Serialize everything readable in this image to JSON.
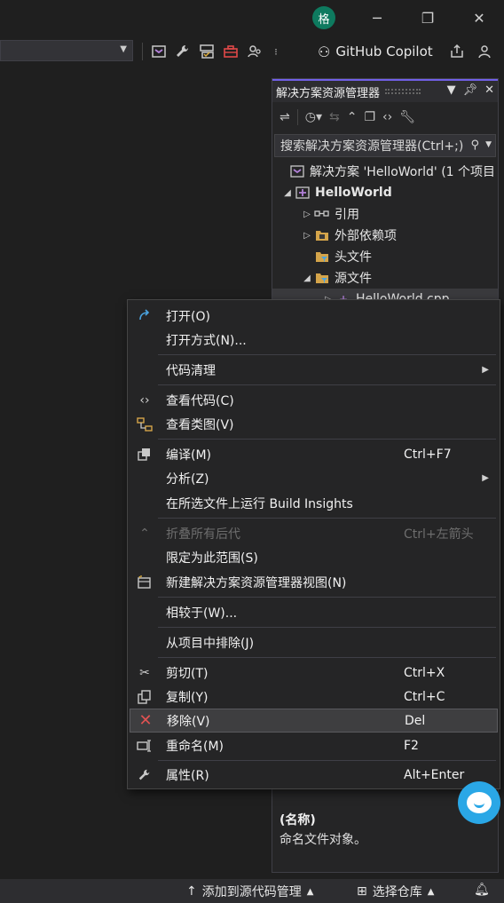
{
  "titlebar": {
    "avatar_initial": "格",
    "minimize": "─",
    "restore": "❐",
    "close": "✕"
  },
  "toolbar": {
    "copilot_label": "GitHub Copilot",
    "icons": [
      "project-icon",
      "wrench-icon",
      "task-icon",
      "toolbox-icon",
      "user-search-icon",
      "overflow-icon"
    ]
  },
  "solution_explorer": {
    "title": "解决方案资源管理器",
    "search_placeholder": "搜索解决方案资源管理器(Ctrl+;)",
    "tree": [
      {
        "label": "解决方案 'HelloWorld' (1 个项目",
        "expander": "",
        "icon": "solution-icon",
        "indent": 0
      },
      {
        "label": "HelloWorld",
        "expander": "◢",
        "icon": "project-icon",
        "indent": 1,
        "bold": true
      },
      {
        "label": "引用",
        "expander": "▷",
        "icon": "references-icon",
        "indent": 2
      },
      {
        "label": "外部依赖项",
        "expander": "▷",
        "icon": "external-deps-icon",
        "indent": 2
      },
      {
        "label": "头文件",
        "expander": "",
        "icon": "filter-folder-icon",
        "indent": 2
      },
      {
        "label": "源文件",
        "expander": "◢",
        "icon": "filter-folder-icon",
        "indent": 2
      },
      {
        "label": "HelloWorld.cpp",
        "expander": "▷",
        "icon": "cpp-file-icon",
        "indent": 3,
        "selected": true
      }
    ],
    "properties": {
      "name": "(名称)",
      "desc": "命名文件对象。"
    }
  },
  "context_menu": {
    "items": [
      {
        "label": "打开(O)",
        "shortcut": "",
        "icon": "open-icon"
      },
      {
        "label": "打开方式(N)...",
        "shortcut": "",
        "icon": ""
      },
      {
        "label": "代码清理",
        "shortcut": "",
        "icon": "",
        "submenu": true
      },
      {
        "label": "查看代码(C)",
        "shortcut": "",
        "icon": "code-icon"
      },
      {
        "label": "查看类图(V)",
        "shortcut": "",
        "icon": "class-diagram-icon"
      },
      {
        "label": "编译(M)",
        "shortcut": "Ctrl+F7",
        "icon": "compile-icon"
      },
      {
        "label": "分析(Z)",
        "shortcut": "",
        "icon": "",
        "submenu": true
      },
      {
        "label": "在所选文件上运行 Build Insights",
        "shortcut": "",
        "icon": ""
      },
      {
        "label": "折叠所有后代",
        "shortcut": "Ctrl+左箭头",
        "icon": "collapse-icon",
        "disabled": true
      },
      {
        "label": "限定为此范围(S)",
        "shortcut": "",
        "icon": ""
      },
      {
        "label": "新建解决方案资源管理器视图(N)",
        "shortcut": "",
        "icon": "new-view-icon"
      },
      {
        "label": "相较于(W)...",
        "shortcut": "",
        "icon": ""
      },
      {
        "label": "从项目中排除(J)",
        "shortcut": "",
        "icon": ""
      },
      {
        "label": "剪切(T)",
        "shortcut": "Ctrl+X",
        "icon": "cut-icon"
      },
      {
        "label": "复制(Y)",
        "shortcut": "Ctrl+C",
        "icon": "copy-icon"
      },
      {
        "label": "移除(V)",
        "shortcut": "Del",
        "icon": "remove-icon",
        "highlighted": true
      },
      {
        "label": "重命名(M)",
        "shortcut": "F2",
        "icon": "rename-icon"
      },
      {
        "label": "属性(R)",
        "shortcut": "Alt+Enter",
        "icon": "wrench-icon"
      }
    ]
  },
  "statusbar": {
    "add_source_control": "添加到源代码管理",
    "select_repo": "选择仓库"
  },
  "colors": {
    "accent": "#7160e8",
    "menu_bg": "#252526",
    "remove_icon": "#e05252"
  }
}
